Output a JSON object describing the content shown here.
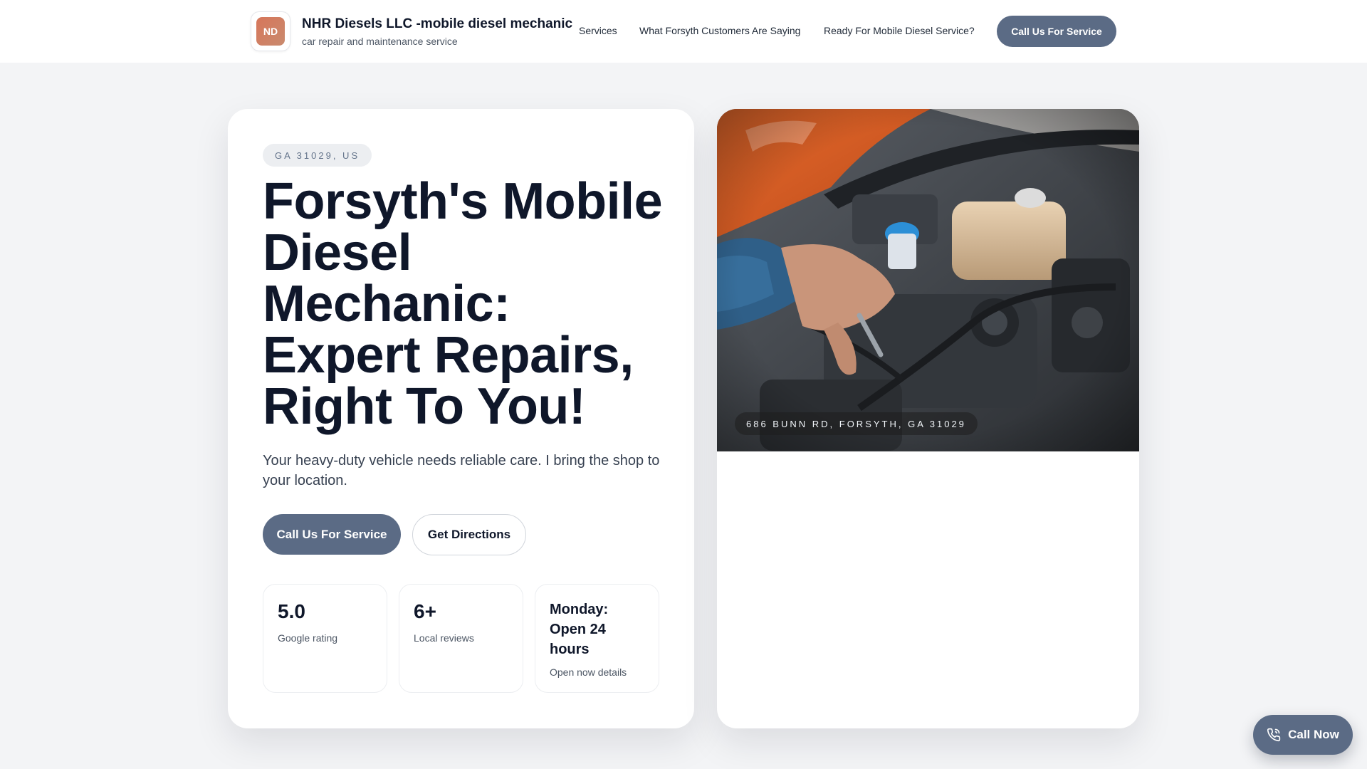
{
  "header": {
    "logo_initials": "ND",
    "brand_name": "NHR Diesels LLC -mobile diesel mechanic",
    "tagline": "car repair and maintenance service",
    "nav": [
      {
        "label": "Services"
      },
      {
        "label": "What Forsyth Customers Are Saying"
      },
      {
        "label": "Ready For Mobile Diesel Service?"
      }
    ],
    "cta_label": "Call Us For Service"
  },
  "hero": {
    "location_chip": "GA 31029, US",
    "title": "Forsyth's Mobile Diesel Mechanic: Expert Repairs, Right To You!",
    "subtitle": "Your heavy-duty vehicle needs reliable care. I bring the shop to your location.",
    "primary_button": "Call Us For Service",
    "secondary_button": "Get Directions",
    "stats": [
      {
        "value": "5.0",
        "label": "Google rating"
      },
      {
        "value": "6+",
        "label": "Local reviews"
      },
      {
        "value": "Monday: Open 24 hours",
        "label": "Open now details"
      }
    ]
  },
  "media": {
    "photo_icon": "engine-repair-photo",
    "address_chip": "686 BUNN RD, FORSYTH, GA 31029"
  },
  "floating": {
    "icon": "phone-icon",
    "label": "Call Now"
  },
  "colors": {
    "accent": "#5b6b85",
    "page_bg": "#f3f4f6",
    "logo_bg": "#d7765a",
    "text": "#0f172a"
  }
}
